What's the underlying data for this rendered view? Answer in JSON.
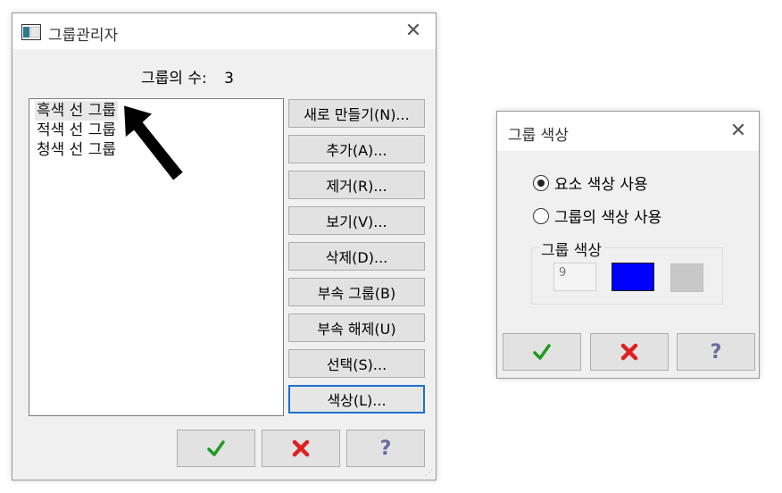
{
  "group_manager": {
    "title": "그룹관리자",
    "count_label": "그룹의 수:",
    "count_value": "3",
    "groups": [
      {
        "label": "흑색 선 그룹",
        "selected": true
      },
      {
        "label": "적색 선 그룹",
        "selected": false
      },
      {
        "label": "청색 선 그룹",
        "selected": false
      }
    ],
    "buttons": {
      "new": "새로 만들기(N)...",
      "add": "추가(A)...",
      "remove": "제거(R)...",
      "view": "보기(V)...",
      "delete": "삭제(D)...",
      "subgroup": "부속 그룹(B)",
      "unsubgroup": "부속 해제(U)",
      "select": "선택(S)...",
      "color": "색상(L)..."
    },
    "footer": {
      "ok_icon": "check-icon",
      "cancel_icon": "cross-icon",
      "help_icon": "question-icon"
    }
  },
  "group_color": {
    "title": "그룹 색상",
    "options": [
      {
        "label": "요소 색상 사용",
        "checked": true
      },
      {
        "label": "그룹의 색상 사용",
        "checked": false
      }
    ],
    "group_box_label": "그룹 색상",
    "color_index": "9",
    "colors": {
      "swatch": "#0000ff",
      "alt_swatch": "#c8c8c8"
    },
    "footer": {
      "ok_icon": "check-icon",
      "cancel_icon": "cross-icon",
      "help_icon": "question-icon"
    }
  },
  "icons": {
    "app": "window-icon",
    "close": "close-icon",
    "annotation": "arrow-pointer"
  }
}
